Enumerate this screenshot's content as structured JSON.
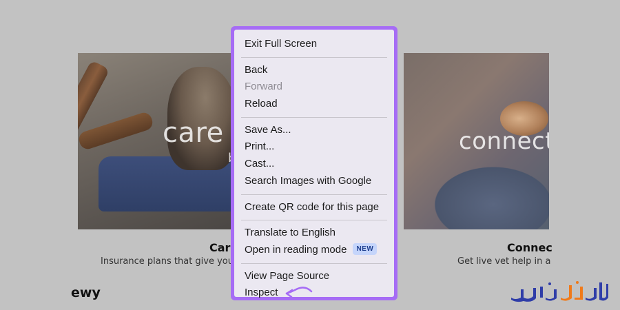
{
  "cards": [
    {
      "overlay_word": "care",
      "overlay_sub": "b",
      "title": "Care",
      "description": "Insurance plans that give you"
    },
    {
      "overlay_word": "connect",
      "title": "Connec",
      "description": "Get live vet help in a"
    }
  ],
  "brand": "ewy",
  "watermark_text": "ایران سرور",
  "context_menu": {
    "highlight_color": "#a66cf5",
    "groups": [
      [
        {
          "label": "Exit Full Screen",
          "enabled": true
        }
      ],
      [
        {
          "label": "Back",
          "enabled": true
        },
        {
          "label": "Forward",
          "enabled": false
        },
        {
          "label": "Reload",
          "enabled": true
        }
      ],
      [
        {
          "label": "Save As...",
          "enabled": true
        },
        {
          "label": "Print...",
          "enabled": true
        },
        {
          "label": "Cast...",
          "enabled": true
        },
        {
          "label": "Search Images with Google",
          "enabled": true
        }
      ],
      [
        {
          "label": "Create QR code for this page",
          "enabled": true
        }
      ],
      [
        {
          "label": "Translate to English",
          "enabled": true
        },
        {
          "label": "Open in reading mode",
          "enabled": true,
          "badge": "NEW"
        }
      ],
      [
        {
          "label": "View Page Source",
          "enabled": true
        },
        {
          "label": "Inspect",
          "enabled": true,
          "annotated": true
        }
      ]
    ]
  }
}
